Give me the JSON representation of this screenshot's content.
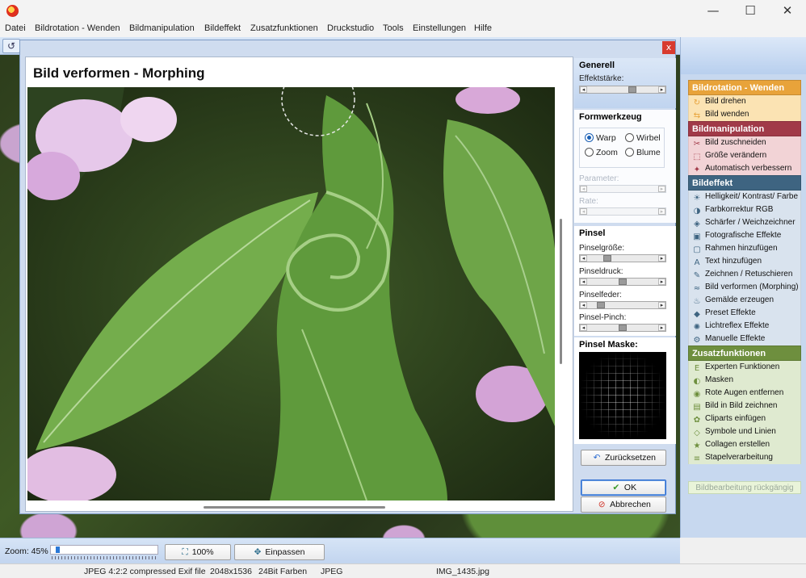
{
  "window": {
    "minimize": "—",
    "maximize": "☐",
    "close": "✕"
  },
  "menu": [
    "Datei",
    "Bildrotation - Wenden",
    "Bildmanipulation",
    "Bildeffekt",
    "Zusatzfunktionen",
    "Druckstudio",
    "Tools",
    "Einstellungen",
    "Hilfe"
  ],
  "dialog": {
    "title": "Bild verformen - Morphing",
    "close": "x",
    "generell": {
      "title": "Generell",
      "effektstaerke_label": "Effektstärke:",
      "effektstaerke_value": 0.65
    },
    "formwerkzeug": {
      "title": "Formwerkzeug",
      "options": [
        {
          "label": "Warp",
          "selected": true
        },
        {
          "label": "Wirbel",
          "selected": false
        },
        {
          "label": "Zoom",
          "selected": false
        },
        {
          "label": "Blume",
          "selected": false
        }
      ],
      "parameter_label": "Parameter:",
      "rate_label": "Rate:"
    },
    "pinsel": {
      "title": "Pinsel",
      "groesse_label": "Pinselgröße:",
      "groesse_value": 0.25,
      "druck_label": "Pinseldruck:",
      "druck_value": 0.5,
      "feder_label": "Pinselfeder:",
      "feder_value": 0.15,
      "pinch_label": "Pinsel-Pinch:",
      "pinch_value": 0.5
    },
    "maske_title": "Pinsel Maske:",
    "reset_label": "Zurücksetzen",
    "ok_label": "OK",
    "cancel_label": "Abbrechen"
  },
  "sidebar": {
    "groups": [
      {
        "title": "Bildrotation - Wenden",
        "color": "#e8a33a",
        "item_bg": "#fbe3b3",
        "items": [
          {
            "label": "Bild drehen",
            "icon": "rotate-icon"
          },
          {
            "label": "Bild wenden",
            "icon": "flip-icon"
          }
        ]
      },
      {
        "title": "Bildmanipulation",
        "color": "#a13a48",
        "item_bg": "#f2d3d6",
        "items": [
          {
            "label": "Bild zuschneiden",
            "icon": "crop-icon"
          },
          {
            "label": "Größe verändern",
            "icon": "resize-icon"
          },
          {
            "label": "Automatisch verbessern",
            "icon": "wand-icon"
          }
        ]
      },
      {
        "title": "Bildeffekt",
        "color": "#3e6481",
        "item_bg": "#d9e3ee",
        "items": [
          {
            "label": "Helligkeit/ Kontrast/ Farbe",
            "icon": "brightness-icon"
          },
          {
            "label": "Farbkorrektur RGB",
            "icon": "rgb-icon"
          },
          {
            "label": "Schärfer / Weichzeichner",
            "icon": "sharpen-icon"
          },
          {
            "label": "Fotografische Effekte",
            "icon": "photo-icon"
          },
          {
            "label": "Rahmen hinzufügen",
            "icon": "frame-icon"
          },
          {
            "label": "Text hinzufügen",
            "icon": "text-icon"
          },
          {
            "label": "Zeichnen / Retuschieren",
            "icon": "draw-icon"
          },
          {
            "label": "Bild verformen (Morphing)",
            "icon": "morph-icon"
          },
          {
            "label": "Gemälde erzeugen",
            "icon": "paint-icon"
          },
          {
            "label": "Preset Effekte",
            "icon": "preset-icon"
          },
          {
            "label": "Lichtreflex Effekte",
            "icon": "light-icon"
          },
          {
            "label": "Manuelle Effekte",
            "icon": "manual-icon"
          }
        ]
      },
      {
        "title": "Zusatzfunktionen",
        "color": "#6e8f3e",
        "item_bg": "#dfead0",
        "items": [
          {
            "label": "Experten Funktionen",
            "icon": "expert-icon"
          },
          {
            "label": "Masken",
            "icon": "mask-icon"
          },
          {
            "label": "Rote Augen entfernen",
            "icon": "eye-icon"
          },
          {
            "label": "Bild in Bild zeichnen",
            "icon": "pip-icon"
          },
          {
            "label": "Cliparts einfügen",
            "icon": "clipart-icon"
          },
          {
            "label": "Symbole und Linien",
            "icon": "symbol-icon"
          },
          {
            "label": "Collagen erstellen",
            "icon": "collage-icon"
          },
          {
            "label": "Stapelverarbeitung",
            "icon": "batch-icon"
          }
        ]
      }
    ],
    "undo_label": "Bildbearbeitung rückgängig"
  },
  "bottom": {
    "zoom_label": "Zoom: 45%",
    "zoom_value": 0.45,
    "btn_100": "100%",
    "btn_fit": "Einpassen"
  },
  "status": [
    "JPEG 4:2:2 compressed Exif file",
    "2048x1536",
    "24Bit Farben",
    "JPEG",
    "IMG_1435.jpg"
  ],
  "colors": {
    "accent": "#2a78d6",
    "panel": "#c7d8ef",
    "leaf": "#6aa84f"
  }
}
